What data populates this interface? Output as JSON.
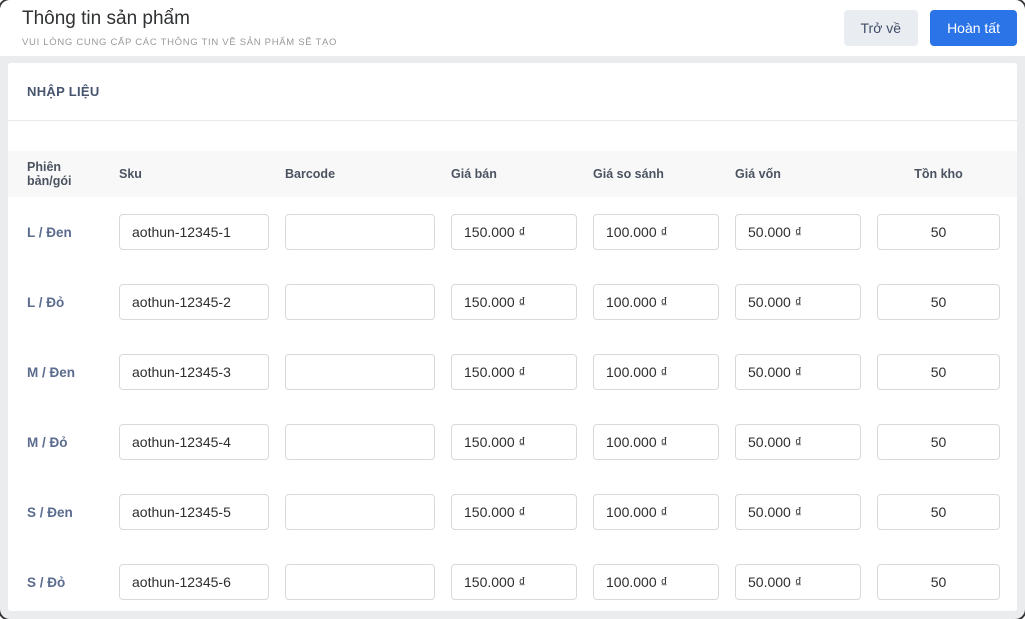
{
  "header": {
    "title": "Thông tin sản phẩm",
    "subtitle": "VUI LÒNG CUNG CẤP CÁC THÔNG TIN VỀ SẢN PHẨM SẼ TẠO",
    "back_button": "Trở về",
    "finish_button": "Hoàn tất"
  },
  "card": {
    "section_title": "NHẬP LIỆU"
  },
  "table": {
    "columns": [
      "Phiên bản/gói",
      "Sku",
      "Barcode",
      "Giá bán",
      "Giá so sánh",
      "Giá vốn",
      "Tồn kho"
    ],
    "rows": [
      {
        "variant": "L / Đen",
        "sku": "aothun-12345-1",
        "barcode": "",
        "price": "150.000 ₫",
        "compare_price": "100.000 ₫",
        "cost_price": "50.000 ₫",
        "stock": "50"
      },
      {
        "variant": "L / Đỏ",
        "sku": "aothun-12345-2",
        "barcode": "",
        "price": "150.000 ₫",
        "compare_price": "100.000 ₫",
        "cost_price": "50.000 ₫",
        "stock": "50"
      },
      {
        "variant": "M / Đen",
        "sku": "aothun-12345-3",
        "barcode": "",
        "price": "150.000 ₫",
        "compare_price": "100.000 ₫",
        "cost_price": "50.000 ₫",
        "stock": "50"
      },
      {
        "variant": "M / Đỏ",
        "sku": "aothun-12345-4",
        "barcode": "",
        "price": "150.000 ₫",
        "compare_price": "100.000 ₫",
        "cost_price": "50.000 ₫",
        "stock": "50"
      },
      {
        "variant": "S / Đen",
        "sku": "aothun-12345-5",
        "barcode": "",
        "price": "150.000 ₫",
        "compare_price": "100.000 ₫",
        "cost_price": "50.000 ₫",
        "stock": "50"
      },
      {
        "variant": "S / Đỏ",
        "sku": "aothun-12345-6",
        "barcode": "",
        "price": "150.000 ₫",
        "compare_price": "100.000 ₫",
        "cost_price": "50.000 ₫",
        "stock": "50"
      }
    ]
  },
  "colors": {
    "accent_blue": "#2b74e8",
    "back_button_bg": "#e9edf2",
    "back_button_text": "#3e4c66",
    "variant_label": "#5b6c8f",
    "table_header_bg": "#f8f8f9",
    "page_background": "#ebecee",
    "input_border": "#d9d9d9"
  }
}
